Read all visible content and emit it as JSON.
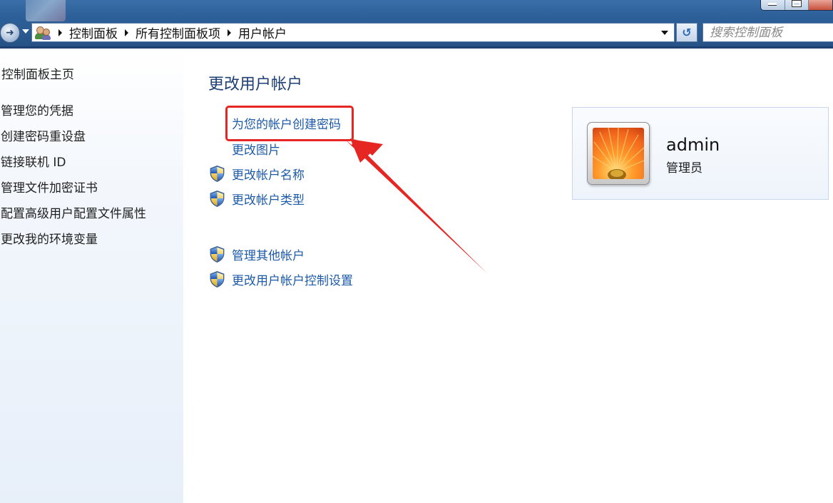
{
  "address_bar": {
    "breadcrumbs": [
      "控制面板",
      "所有控制面板项",
      "用户帐户"
    ]
  },
  "search": {
    "placeholder": "搜索控制面板"
  },
  "sidebar": {
    "home": "控制面板主页",
    "links": [
      "管理您的凭据",
      "创建密码重设盘",
      "链接联机 ID",
      "管理文件加密证书",
      "配置高级用户配置文件属性",
      "更改我的环境变量"
    ]
  },
  "main": {
    "title": "更改用户帐户",
    "tasks": [
      {
        "label": "为您的帐户创建密码",
        "icon": "none"
      },
      {
        "label": "更改图片",
        "icon": "none"
      },
      {
        "label": "更改帐户名称",
        "icon": "uac-shield-icon"
      },
      {
        "label": "更改帐户类型",
        "icon": "uac-shield-icon"
      }
    ],
    "other_tasks": [
      {
        "label": "管理其他帐户",
        "icon": "uac-shield-icon"
      },
      {
        "label": "更改用户帐户控制设置",
        "icon": "uac-shield-icon"
      }
    ]
  },
  "account": {
    "name": "admin",
    "role": "管理员",
    "avatar": "orange-flower-picture"
  },
  "annotation": {
    "color": "#e52623",
    "highlighted_task": "为您的帐户创建密码"
  },
  "colors": {
    "link": "#1d5aa8",
    "title": "#1e3f73",
    "titlebar": "#2d5f98"
  }
}
